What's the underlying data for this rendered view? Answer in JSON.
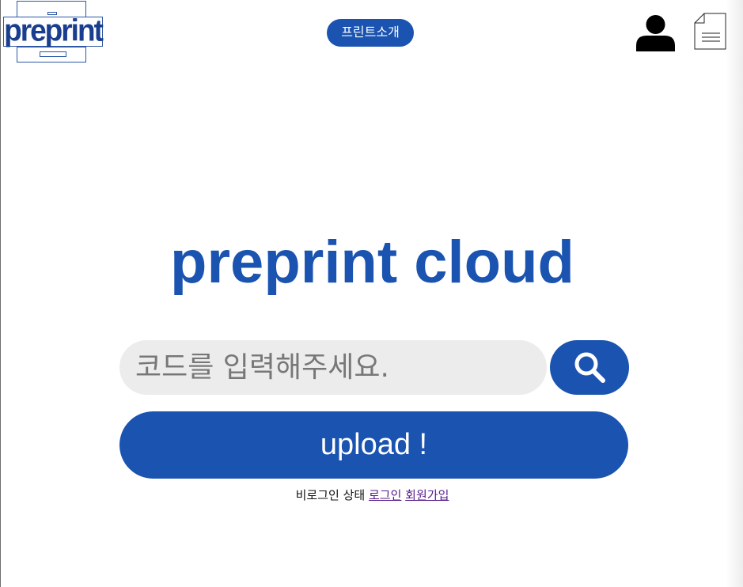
{
  "header": {
    "logo_text": "preprint",
    "intro_button_label": "프린트소개",
    "user_icon": "user-icon",
    "document_icon": "document-icon"
  },
  "main": {
    "title": "preprint cloud",
    "search": {
      "placeholder": "코드를 입력해주세요.",
      "value": "",
      "button_icon": "search-icon"
    },
    "upload_label": "upload !",
    "status": {
      "text": "비로그인 상태",
      "login_link": "로그인",
      "signup_link": "회원가입"
    }
  },
  "colors": {
    "accent": "#1a53b0",
    "logo": "#1a3e8f",
    "input_bg": "#ececec",
    "visited_link": "#551a8b"
  }
}
